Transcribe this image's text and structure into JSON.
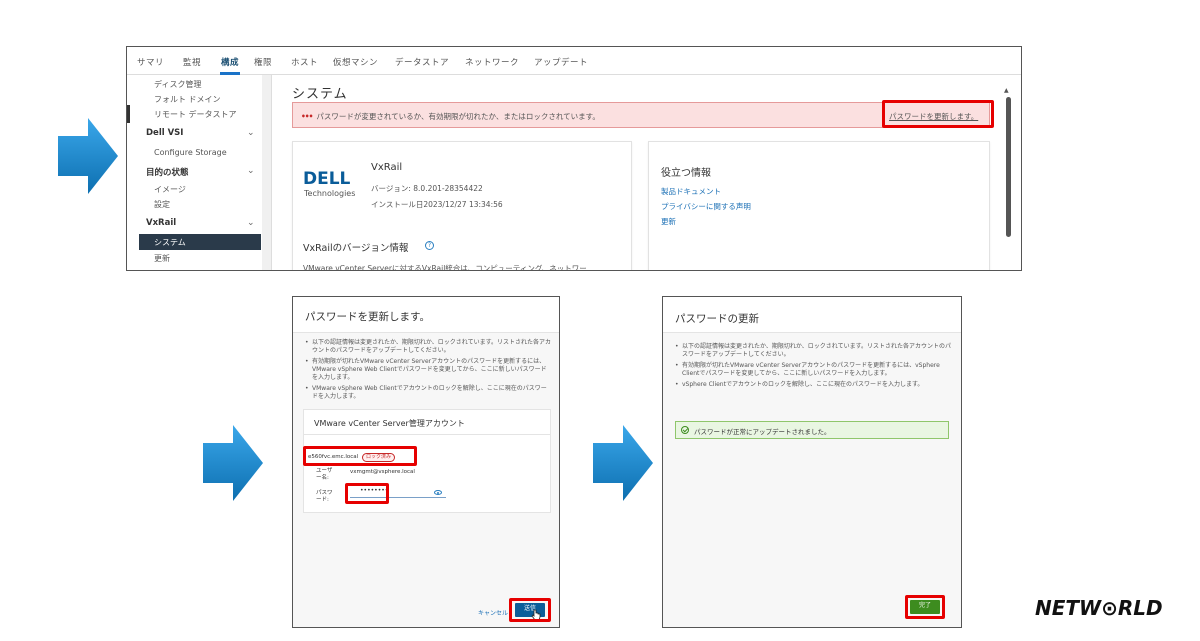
{
  "top": {
    "tabs": [
      "サマリ",
      "監視",
      "構成",
      "権限",
      "ホスト",
      "仮想マシン",
      "データストア",
      "ネットワーク",
      "アップデート"
    ],
    "active_tab": "構成",
    "sidebar": {
      "items_top": [
        "ディスク管理",
        "フォルト ドメイン",
        "リモート データストア"
      ],
      "dell_vsi": "Dell VSI",
      "configure_storage": "Configure Storage",
      "target_state": "目的の状態",
      "image": "イメージ",
      "settings": "設定",
      "vxrail": "VxRail",
      "system": "システム",
      "update": "更新"
    },
    "title": "システム",
    "alert_text": "パスワードが変更されているか、有効期限が切れたか、またはロックされています。",
    "alert_link": "パスワードを更新します。",
    "product": {
      "logo_line1": "DELL",
      "logo_line2": "Technologies",
      "name": "VxRail",
      "version": "バージョン: 8.0.201-28354422",
      "installed": "インストール日2023/12/27 13:34:56"
    },
    "version_info_title": "VxRailのバージョン情報",
    "version_info_text": "VMware vCenter Serverに対するVxRail統合は、コンピューティング、ネットワー",
    "useful": {
      "title": "役立つ情報",
      "links": [
        "製品ドキュメント",
        "プライバシーに関する声明",
        "更新"
      ]
    }
  },
  "dialog1": {
    "title": "パスワードを更新します。",
    "bullets": [
      "以下の認証情報は変更されたか、期限切れか、ロックされています。リストされた各アカウントのパスワードをアップデートしてください。",
      "有効期限が切れたVMware vCenter Serverアカウントのパスワードを更新するには、VMware vSphere Web Clientでパスワードを変更してから、ここに新しいパスワードを入力します。",
      "VMware vSphere Web Clientでアカウントのロックを解除し、ここに現在のパスワードを入力します。"
    ],
    "card_title": "VMware vCenter Server管理アカウント",
    "host": "e560fvc.emc.local",
    "locked_badge": "ロック済み",
    "user_label": "ユーザー名:",
    "user_value": "vxmgmt@vsphere.local",
    "password_label": "パスワード:",
    "password_value": "••••••••",
    "cancel": "キャンセル",
    "submit": "送信"
  },
  "dialog2": {
    "title": "パスワードの更新",
    "bullets": [
      "以下の認証情報は変更されたか、期限切れか、ロックされています。リストされた各アカウントのパスワードをアップデートしてください。",
      "有効期限が切れたVMware vCenter Serverアカウントのパスワードを更新するには、vSphere Clientでパスワードを変更してから、ここに新しいパスワードを入力します。",
      "vSphere Clientでアカウントのロックを解除し、ここに現在のパスワードを入力します。"
    ],
    "success": "パスワードが正常にアップデートされました。",
    "done": "完了"
  },
  "brand": "NETW⊙RLD",
  "colors": {
    "highlight": "#e60000",
    "arrow": "#1a8fd6",
    "alert_bg": "#fbe0e0",
    "success_bg": "#e9f6e2"
  }
}
